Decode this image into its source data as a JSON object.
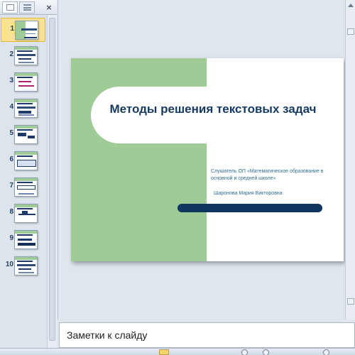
{
  "thumbnails": {
    "items": [
      {
        "number": "1",
        "selected": true
      },
      {
        "number": "2"
      },
      {
        "number": "3"
      },
      {
        "number": "4"
      },
      {
        "number": "5"
      },
      {
        "number": "6"
      },
      {
        "number": "7"
      },
      {
        "number": "8"
      },
      {
        "number": "9"
      },
      {
        "number": "10"
      }
    ],
    "close_glyph": "×"
  },
  "slide": {
    "title": "Методы решения текстовых задач",
    "subtitle": "Слушатель  ОП «Математическое образование   в основной   и средней школе»",
    "author": "Шаронова   Мария  Викторовна"
  },
  "notes": {
    "placeholder": "Заметки к слайду"
  },
  "colors": {
    "green_panel": "#9fcb96",
    "title": "#173a63",
    "accent_bar": "#0e3660",
    "selection": "#fbe293"
  }
}
